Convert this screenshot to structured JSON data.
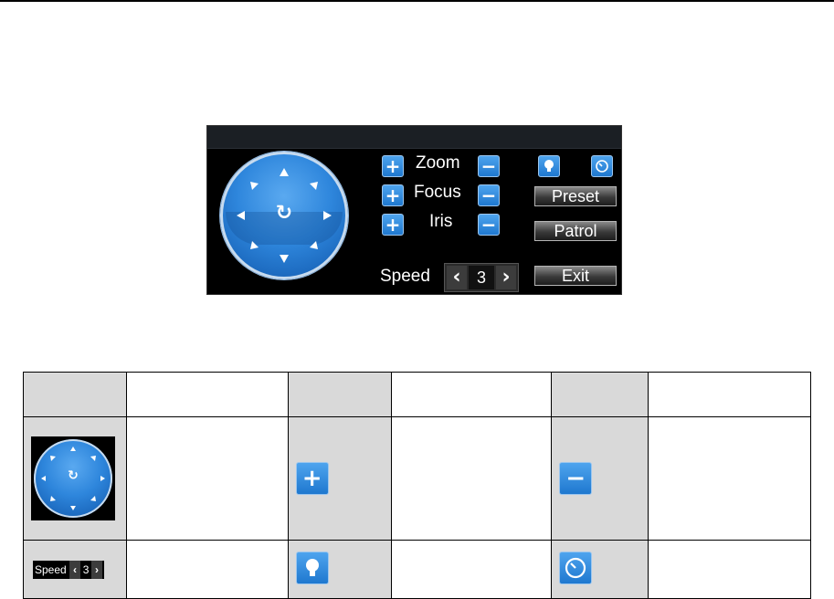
{
  "ptz_panel": {
    "zoom_label": "Zoom",
    "focus_label": "Focus",
    "iris_label": "Iris",
    "plus_glyph": "+",
    "minus_glyph": "−",
    "preset_label": "Preset",
    "patrol_label": "Patrol",
    "exit_label": "Exit",
    "speed_label": "Speed",
    "speed_value": "3",
    "speed_prev_glyph": "‹",
    "speed_next_glyph": "›",
    "center_glyph": "↻",
    "accent_color": "#2e86dc"
  },
  "legend_table": {
    "speed_label": "Speed",
    "speed_value": "3",
    "plus_glyph": "+",
    "minus_glyph": "−"
  }
}
